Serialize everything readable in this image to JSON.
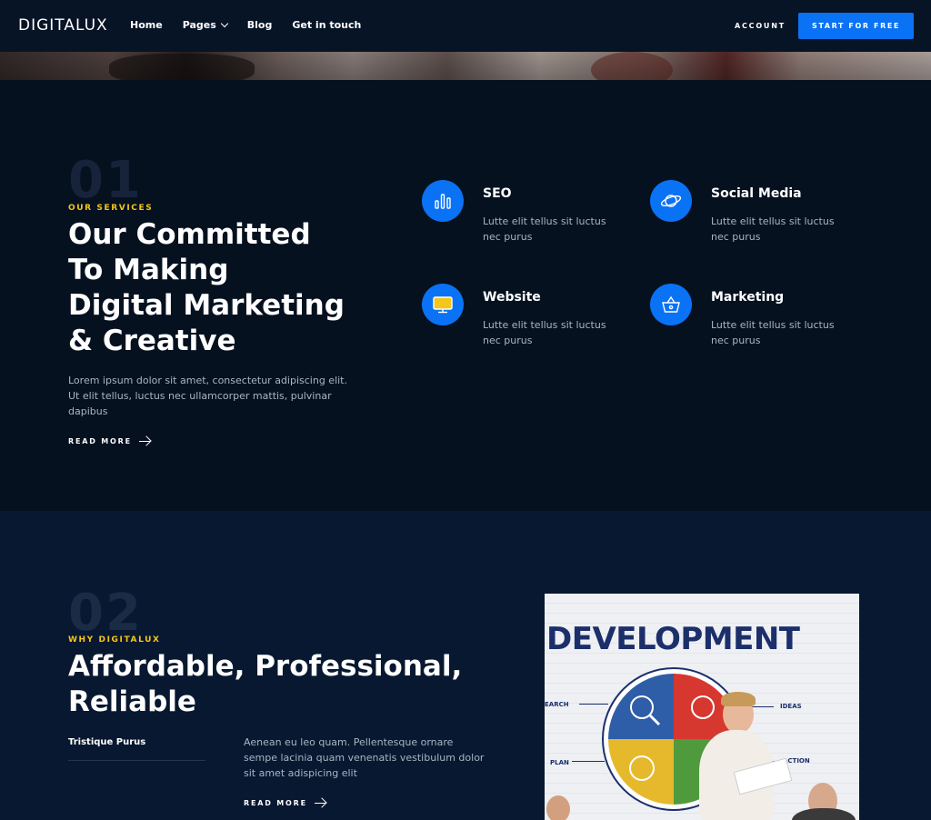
{
  "header": {
    "logo": "DIGITALUX",
    "nav": [
      {
        "label": "Home"
      },
      {
        "label": "Pages"
      },
      {
        "label": "Blog"
      },
      {
        "label": "Get in touch"
      }
    ],
    "account_label": "ACCOUNT",
    "cta_label": "START FOR FREE"
  },
  "services_section": {
    "number": "01",
    "eyebrow": "OUR SERVICES",
    "title_lines": [
      "Our Committed",
      "To Making",
      "Digital Marketing",
      "& Creative"
    ],
    "description": "Lorem ipsum dolor sit amet, consectetur adipiscing elit. Ut elit tellus, luctus nec ullamcorper mattis, pulvinar dapibus",
    "read_more": "READ MORE",
    "services": [
      {
        "title": "SEO",
        "description": "Lutte elit tellus sit luctus nec purus",
        "icon": "bar-chart-icon"
      },
      {
        "title": "Social Media",
        "description": "Lutte elit tellus sit luctus nec purus",
        "icon": "planet-icon"
      },
      {
        "title": "Website",
        "description": "Lutte elit tellus sit luctus nec purus",
        "icon": "monitor-icon"
      },
      {
        "title": "Marketing",
        "description": "Lutte elit tellus sit luctus nec purus",
        "icon": "basket-icon"
      }
    ]
  },
  "why_section": {
    "number": "02",
    "eyebrow": "WHY DIGITALUX",
    "title_lines": [
      "Affordable, Professional,",
      "Reliable"
    ],
    "subtitle": "Tristique Purus",
    "description": "Aenean eu leo quam. Pellentesque ornare sempe lacinia quam venenatis vestibulum dolor sit amet adispicing elit",
    "read_more": "READ MORE",
    "image": {
      "headline": "DEVELOPMENT",
      "labels": [
        "EARCH",
        "IDEAS",
        "PLAN",
        "ACTION"
      ]
    }
  },
  "colors": {
    "accent": "#0a72f5",
    "eyebrow": "#f5c518",
    "background": "#05111f",
    "background_alt": "#081830"
  }
}
